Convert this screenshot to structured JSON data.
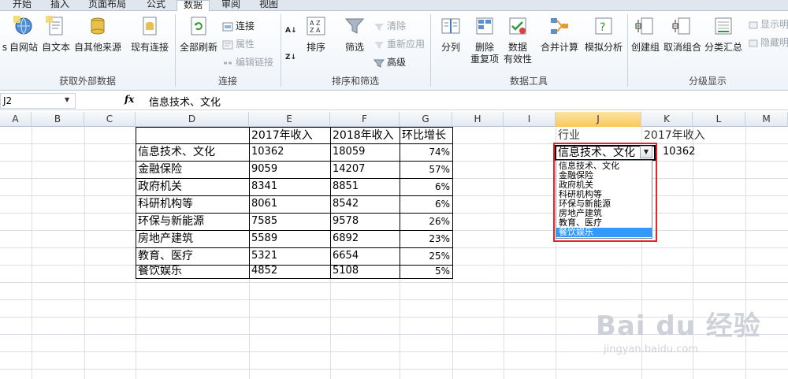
{
  "tabs": [
    {
      "label": "开始",
      "active": false
    },
    {
      "label": "插入",
      "active": false
    },
    {
      "label": "页面布局",
      "active": false
    },
    {
      "label": "公式",
      "active": false
    },
    {
      "label": "数据",
      "active": true
    },
    {
      "label": "审阅",
      "active": false
    },
    {
      "label": "视图",
      "active": false
    }
  ],
  "ribbon": {
    "external": {
      "label": "获取外部数据",
      "b1": "s",
      "b2": "自网站",
      "b3": "自文本",
      "b4": "自其他来源",
      "b5": "现有连接"
    },
    "connections": {
      "label": "连接",
      "refresh_all": "全部刷新",
      "connections": "连接",
      "properties": "属性",
      "edit_links": "编辑链接"
    },
    "sort_filter": {
      "label": "排序和筛选",
      "sort": "排序",
      "filter": "筛选",
      "clear": "清除",
      "reapply": "重新应用",
      "advanced": "高级"
    },
    "data_tools": {
      "label": "数据工具",
      "split": "分列",
      "remove_dup_1": "删除",
      "remove_dup_2": "重复项",
      "validation_1": "数据",
      "validation_2": "有效性",
      "consolidate": "合并计算",
      "whatif": "模拟分析"
    },
    "outline": {
      "label": "分级显示",
      "group": "创建组",
      "ungroup": "取消组合",
      "subtotal": "分类汇总",
      "show_detail": "显示明",
      "hide_detail": "隐藏明"
    }
  },
  "formula_bar": {
    "name_box": "J2",
    "fx": "fx",
    "content": "信息技术、文化"
  },
  "columns": [
    "A",
    "B",
    "C",
    "D",
    "E",
    "F",
    "G",
    "H",
    "I",
    "J",
    "K",
    "L",
    "M"
  ],
  "selected_column": "J",
  "table": {
    "headers": [
      "2017年收入",
      "2018年收入",
      "环比增长"
    ],
    "rows": [
      {
        "industry": "信息技术、文化",
        "r2017": "10362",
        "r2018": "18059",
        "growth": "74%"
      },
      {
        "industry": "金融保险",
        "r2017": "9059",
        "r2018": "14207",
        "growth": "57%"
      },
      {
        "industry": "政府机关",
        "r2017": "8341",
        "r2018": "8851",
        "growth": "6%"
      },
      {
        "industry": "科研机构等",
        "r2017": "8061",
        "r2018": "8542",
        "growth": "6%"
      },
      {
        "industry": "环保与新能源",
        "r2017": "7585",
        "r2018": "9578",
        "growth": "26%"
      },
      {
        "industry": "房地产建筑",
        "r2017": "5589",
        "r2018": "6892",
        "growth": "23%"
      },
      {
        "industry": "教育、医疗",
        "r2017": "5321",
        "r2018": "6654",
        "growth": "25%"
      },
      {
        "industry": "餐饮娱乐",
        "r2017": "4852",
        "r2018": "5108",
        "growth": "5%"
      }
    ]
  },
  "lookup": {
    "industry_header": "行业",
    "revenue_header": "2017年收入",
    "selected_value": "信息技术、文化",
    "result_value": "10362"
  },
  "dropdown": {
    "options": [
      "信息技术、文化",
      "金融保险",
      "政府机关",
      "科研机构等",
      "环保与新能源",
      "房地产建筑",
      "教育、医疗",
      "餐饮娱乐"
    ],
    "highlighted": "餐饮娱乐"
  },
  "watermark": {
    "brand": "Bai du 经验",
    "url": "jingyan.baidu.com"
  },
  "colors": {
    "selection": "#3399ff",
    "highlight_frame": "#e0262a",
    "selected_column_header": "#f8c85a"
  }
}
